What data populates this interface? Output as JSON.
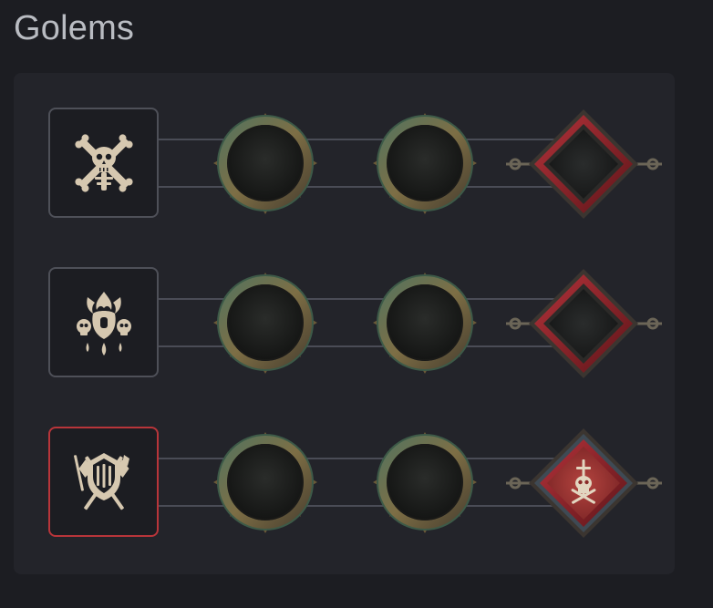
{
  "page": {
    "title": "Golems"
  },
  "colors": {
    "background": "#1c1d22",
    "panel": "#23242a",
    "card_border": "#4e5058",
    "card_border_selected": "#b8353a",
    "icon_bone": "#d6c8b0",
    "ring_green": "#4f6e55",
    "ring_gold": "#8c7a48",
    "diamond_red": "#8f2226",
    "diamond_active_fill": "#a73a37"
  },
  "golems": [
    {
      "icon": "bone-golem-icon",
      "selected": false,
      "nodes": [
        "empty-ring-node",
        "empty-ring-node",
        "empty-diamond-node"
      ]
    },
    {
      "icon": "blood-golem-icon",
      "selected": false,
      "nodes": [
        "empty-ring-node",
        "empty-ring-node",
        "empty-diamond-node"
      ]
    },
    {
      "icon": "iron-golem-icon",
      "selected": true,
      "nodes": [
        "empty-ring-node",
        "empty-ring-node",
        "active-skull-diamond-node"
      ]
    }
  ]
}
